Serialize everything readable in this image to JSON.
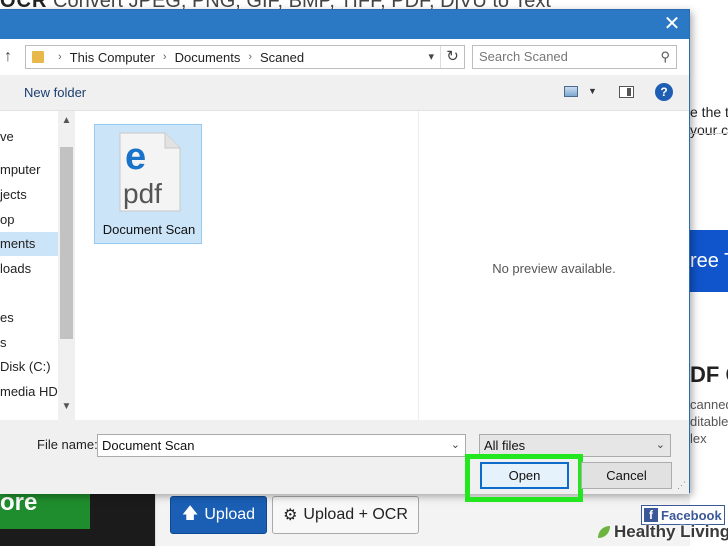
{
  "background_page": {
    "top_title_bold": "OCR",
    "top_title": "Convert JPEG, PNG, GIF, BMP, TIFF, PDF, DjVU to Text",
    "right_fragments": [
      "e the te",
      "your c"
    ],
    "blue_button_text": "ree T",
    "heading_fragment": "DF C",
    "small_fragments": [
      "canned",
      "ditable",
      "lex"
    ],
    "green_button_text": "ore",
    "upload_button": "Upload",
    "upload_ocr_button": "Upload + OCR",
    "facebook_icon": "f",
    "facebook_label": "Facebook",
    "watermark": "Healthy Living"
  },
  "dialog": {
    "close_glyph": "✕",
    "nav": {
      "breadcrumbs": [
        "This Computer",
        "Documents",
        "Scaned"
      ],
      "search_placeholder": "Search Scaned",
      "up_glyph": "↑",
      "refresh_glyph": "↻",
      "search_glyph": "⚲"
    },
    "toolbar": {
      "new_folder": "New folder",
      "help_glyph": "?"
    },
    "sidebar": {
      "items": [
        {
          "label": "ve",
          "selected": false
        },
        {
          "label": "mputer",
          "selected": false
        },
        {
          "label": "jects",
          "selected": false
        },
        {
          "label": "op",
          "selected": false
        },
        {
          "label": "ments",
          "selected": true
        },
        {
          "label": "loads",
          "selected": false
        },
        {
          "label": "",
          "selected": false
        },
        {
          "label": "es",
          "selected": false
        },
        {
          "label": "s",
          "selected": false
        },
        {
          "label": "Disk (C:)",
          "selected": false
        },
        {
          "label": "media HDD",
          "selected": false
        }
      ]
    },
    "file": {
      "name": "Document Scan",
      "icon_text": "pdf",
      "icon_letter": "e"
    },
    "preview_text": "No preview available.",
    "footer": {
      "file_name_label": "File name:",
      "file_name_value": "Document Scan",
      "file_type_value": "All files",
      "open_label": "Open",
      "cancel_label": "Cancel"
    }
  },
  "colors": {
    "titlebar": "#2b78c5",
    "selection": "#cce4f7",
    "highlight": "#22e61e",
    "upload_blue": "#1a5fb4"
  }
}
